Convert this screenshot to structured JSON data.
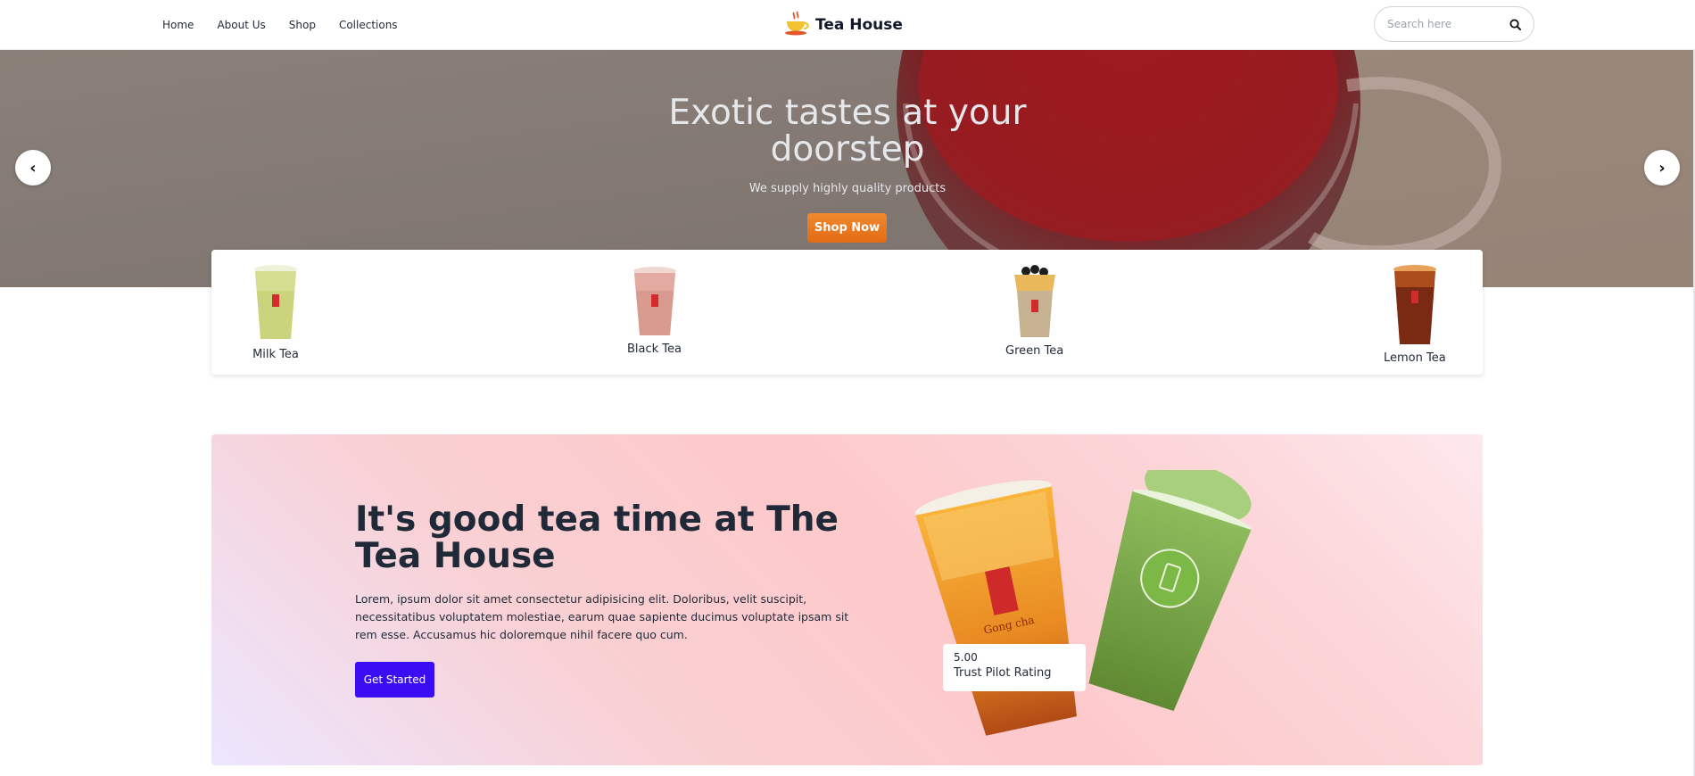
{
  "nav": {
    "links": [
      "Home",
      "About Us",
      "Shop",
      "Collections"
    ],
    "brand": "Tea House",
    "search_placeholder": "Search here"
  },
  "hero": {
    "title": "Exotic tastes at your doorstep",
    "subtitle": "We supply highly quality products",
    "cta": "Shop Now",
    "prev": "‹",
    "next": "›"
  },
  "categories": [
    {
      "label": "Milk Tea",
      "color": "#c8d47a"
    },
    {
      "label": "Black Tea",
      "color": "#d8a397"
    },
    {
      "label": "Green Tea",
      "color": "#c9b18f"
    },
    {
      "label": "Lemon Tea",
      "color": "#7a2b14"
    }
  ],
  "promo": {
    "title": "It's good tea time at The Tea House",
    "text": "Lorem, ipsum dolor sit amet consectetur adipisicing elit. Doloribus, velit suscipit, necessitatibus voluptatem molestiae, earum quae sapiente ducimus voluptate ipsam sit rem esse. Accusamus hic doloremque nihil facere quo cum.",
    "cta": "Get Started",
    "rating_value": "5.00",
    "rating_label": "Trust Pilot Rating"
  },
  "colors": {
    "accent_orange": "#e8761f",
    "accent_blue": "#3b0df5"
  }
}
